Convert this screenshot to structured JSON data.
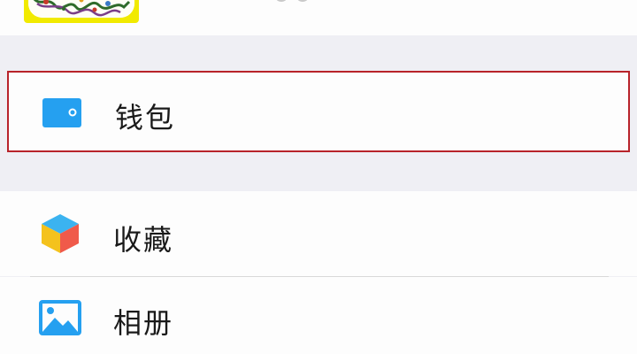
{
  "menu": {
    "items": [
      {
        "label": "钱包",
        "icon": "wallet-icon",
        "highlighted": true,
        "highlight_color": "#b8232a",
        "icon_color": "#25a0f0"
      },
      {
        "label": "收藏",
        "icon": "favorites-cube-icon",
        "highlighted": false
      },
      {
        "label": "相册",
        "icon": "album-image-icon",
        "highlighted": false,
        "icon_color": "#25a0f0"
      }
    ]
  },
  "colors": {
    "background": "#efeff4",
    "row_background": "#fdfdfd",
    "text": "#1a1a1a",
    "divider": "#d9d9d9"
  }
}
